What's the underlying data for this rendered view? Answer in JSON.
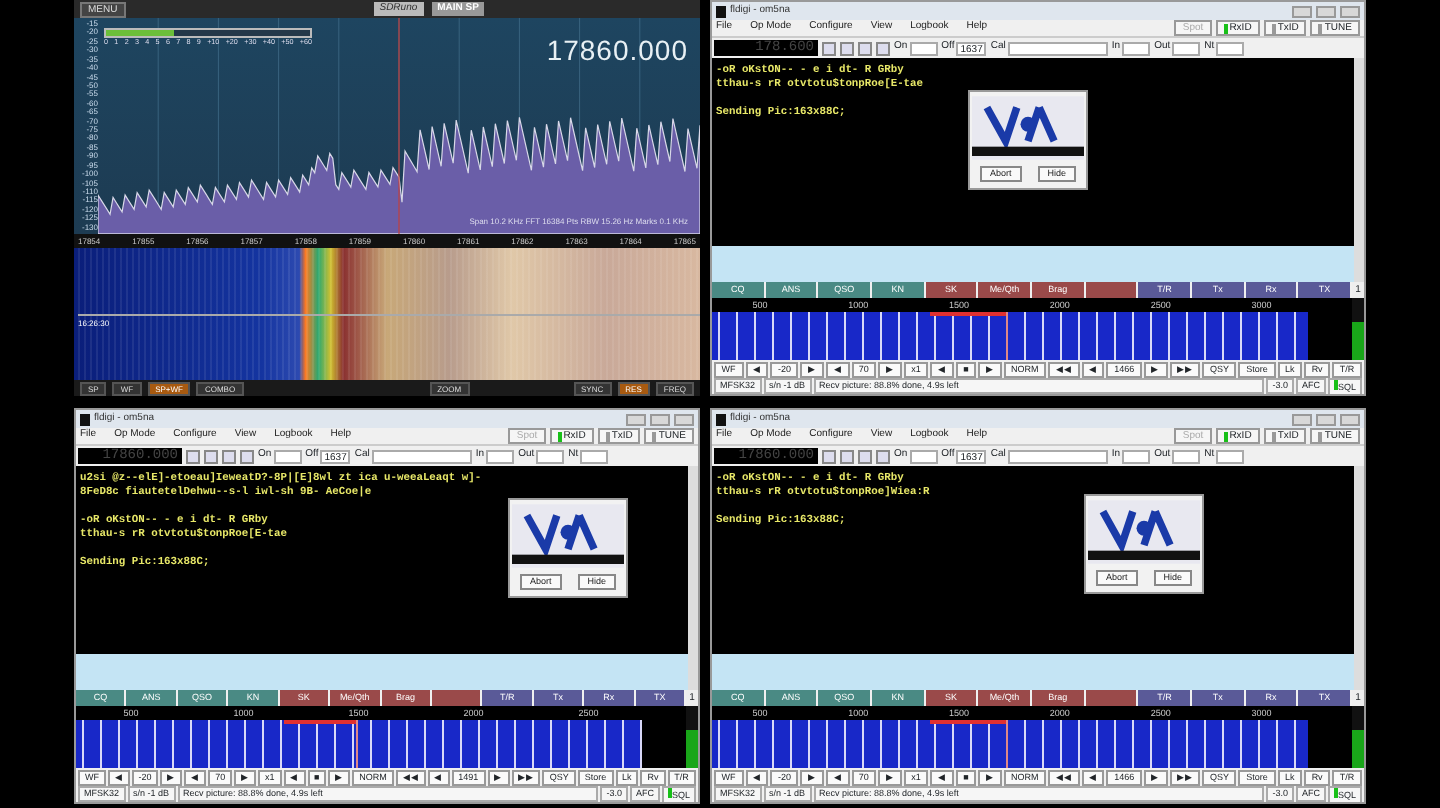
{
  "sdr": {
    "menu_button": "MENU",
    "logo": "SDRuno",
    "tab": "MAIN SP",
    "frequency": "17860.000",
    "smeter": {
      "level": 0.33,
      "scale": [
        "0",
        "1",
        "2",
        "3",
        "4",
        "5",
        "6",
        "7",
        "8",
        "9",
        "+10",
        "+20",
        "+30",
        "+40",
        "+50",
        "+60"
      ]
    },
    "db_scale": [
      "-15",
      "-20",
      "-25",
      "-30",
      "-35",
      "-40",
      "-45",
      "-50",
      "-55",
      "-60",
      "-65",
      "-70",
      "-75",
      "-80",
      "-85",
      "-90",
      "-95",
      "-100",
      "-105",
      "-110",
      "-115",
      "-120",
      "-125",
      "-130"
    ],
    "info": "Span 10.2 KHz   FFT 16384 Pts   RBW 15.26 Hz   Marks 0.1 KHz",
    "freq_axis": [
      "17854",
      "17855",
      "17856",
      "17857",
      "17858",
      "17859",
      "17860",
      "17861",
      "17862",
      "17863",
      "17864",
      "17865"
    ],
    "timestamp": "16:26:30",
    "buttons": [
      {
        "label": "SP",
        "selected": false
      },
      {
        "label": "WF",
        "selected": false
      },
      {
        "label": "SP+WF",
        "selected": true
      },
      {
        "label": "COMBO",
        "selected": false
      }
    ],
    "zoom": "ZOOM",
    "right_buttons": [
      {
        "label": "SYNC",
        "selected": false
      },
      {
        "label": "RES",
        "selected": true
      },
      {
        "label": "FREQ",
        "selected": false
      }
    ]
  },
  "fldigi_windows": [
    {
      "title": "fldigi - om5na",
      "menu": [
        "File",
        "Op Mode",
        "Configure",
        "View",
        "Logbook",
        "Help"
      ],
      "buttons": [
        {
          "label": "Spot",
          "on": false,
          "disabled": true
        },
        {
          "label": "RxID",
          "on": true,
          "disabled": false
        },
        {
          "label": "TxID",
          "on": false,
          "disabled": false
        },
        {
          "label": "TUNE",
          "on": false,
          "disabled": false
        }
      ],
      "frequency": "178.600",
      "fields": [
        {
          "label": "On"
        },
        {
          "label": "Off",
          "value": "1637"
        },
        {
          "label": "Cal"
        },
        {
          "label": "In"
        },
        {
          "label": "Out"
        },
        {
          "label": "Nt"
        }
      ],
      "rx_paragraphs": [
        [
          "-oR oKstON-- - e i dt- R GRby",
          "tthau-s rR otvtotu$tonpRoe[E-tae"
        ],
        [
          "Sending Pic:163x88C;"
        ]
      ],
      "popup": {
        "buttons": [
          "Abort",
          "Hide"
        ]
      },
      "macros": [
        {
          "label": "CQ",
          "color": "#4a8a84"
        },
        {
          "label": "ANS",
          "color": "#4a8a84"
        },
        {
          "label": "QSO",
          "color": "#4a8a84"
        },
        {
          "label": "KN",
          "color": "#4a8a84"
        },
        {
          "label": "SK",
          "color": "#9a4a4a"
        },
        {
          "label": "Me/Qth",
          "color": "#9a4a4a"
        },
        {
          "label": "Brag",
          "color": "#9a4a4a"
        },
        {
          "color": "#9a4a4a"
        },
        {
          "label": "T/R",
          "color": "#5a5a98"
        },
        {
          "label": "Tx",
          "color": "#5a5a98"
        },
        {
          "label": "Rx",
          "color": "#5a5a98"
        },
        {
          "label": "TX",
          "color": "#5a5a98"
        }
      ],
      "macro_page": "1",
      "wf_scale": [
        "500",
        "1000",
        "1500",
        "2000",
        "2500",
        "3000"
      ],
      "controls": [
        "WF",
        "◀",
        "-20",
        "▶",
        "◀",
        "70",
        "▶",
        "x1",
        "◀",
        "■",
        "▶",
        "NORM",
        "◀◀",
        "◀",
        "1466",
        "▶",
        "▶▶",
        "QSY",
        "Store",
        "Lk",
        "Rv",
        "T/R"
      ],
      "status": {
        "mode": "MFSK32",
        "snr": "s/n -1 dB",
        "message": "Recv picture: 88.8% done, 4.9s left",
        "afc_value": "-3.0",
        "afc": "AFC",
        "sql": "SQL",
        "sql_on": true
      },
      "level": 0.62
    },
    {
      "title": "fldigi - om5na",
      "menu": [
        "File",
        "Op Mode",
        "Configure",
        "View",
        "Logbook",
        "Help"
      ],
      "buttons": [
        {
          "label": "Spot",
          "on": false,
          "disabled": true
        },
        {
          "label": "RxID",
          "on": true,
          "disabled": false
        },
        {
          "label": "TxID",
          "on": false,
          "disabled": false
        },
        {
          "label": "TUNE",
          "on": false,
          "disabled": false
        }
      ],
      "frequency": "17860.000",
      "fields": [
        {
          "label": "On"
        },
        {
          "label": "Off",
          "value": "1637"
        },
        {
          "label": "Cal"
        },
        {
          "label": "In"
        },
        {
          "label": "Out"
        },
        {
          "label": "Nt"
        }
      ],
      "rx_paragraphs": [
        [
          "u2si @z--elE]-etoeau]IeweatD?-8P|[E]8wl zt ica u-weeaLeaqt w]-",
          "8FeD8c fiautetelDehwu--s-l iwl-sh 9B- AeCoe|e"
        ],
        [
          "-oR oKstON-- - e i dt- R GRby",
          "tthau-s rR otvtotu$tonpRoe[E-tae"
        ],
        [
          "Sending Pic:163x88C;"
        ]
      ],
      "popup": {
        "buttons": [
          "Abort",
          "Hide"
        ]
      },
      "macros": [
        {
          "label": "CQ",
          "color": "#4a8a84"
        },
        {
          "label": "ANS",
          "color": "#4a8a84"
        },
        {
          "label": "QSO",
          "color": "#4a8a84"
        },
        {
          "label": "KN",
          "color": "#4a8a84"
        },
        {
          "label": "SK",
          "color": "#9a4a4a"
        },
        {
          "label": "Me/Qth",
          "color": "#9a4a4a"
        },
        {
          "label": "Brag",
          "color": "#9a4a4a"
        },
        {
          "color": "#9a4a4a"
        },
        {
          "label": "T/R",
          "color": "#5a5a98"
        },
        {
          "label": "Tx",
          "color": "#5a5a98"
        },
        {
          "label": "Rx",
          "color": "#5a5a98"
        },
        {
          "label": "TX",
          "color": "#5a5a98"
        }
      ],
      "macro_page": "1",
      "wf_scale": [
        "500",
        "1000",
        "1500",
        "2000",
        "2500"
      ],
      "controls": [
        "WF",
        "◀",
        "-20",
        "▶",
        "◀",
        "70",
        "▶",
        "x1",
        "◀",
        "■",
        "▶",
        "NORM",
        "◀◀",
        "◀",
        "1491",
        "▶",
        "▶▶",
        "QSY",
        "Store",
        "Lk",
        "Rv",
        "T/R"
      ],
      "status": {
        "mode": "MFSK32",
        "snr": "s/n -1 dB",
        "message": "Recv picture: 88.8% done, 4.9s left",
        "afc_value": "-3.0",
        "afc": "AFC",
        "sql": "SQL",
        "sql_on": true
      },
      "level": 0.62
    },
    {
      "title": "fldigi - om5na",
      "menu": [
        "File",
        "Op Mode",
        "Configure",
        "View",
        "Logbook",
        "Help"
      ],
      "buttons": [
        {
          "label": "Spot",
          "on": false,
          "disabled": true
        },
        {
          "label": "RxID",
          "on": true,
          "disabled": false
        },
        {
          "label": "TxID",
          "on": false,
          "disabled": false
        },
        {
          "label": "TUNE",
          "on": false,
          "disabled": false
        }
      ],
      "frequency": "17860.000",
      "fields": [
        {
          "label": "On"
        },
        {
          "label": "Off",
          "value": "1637"
        },
        {
          "label": "Cal"
        },
        {
          "label": "In"
        },
        {
          "label": "Out"
        },
        {
          "label": "Nt"
        }
      ],
      "rx_paragraphs": [
        [
          "-oR oKstON-- - e i dt- R GRby",
          "tthau-s rR otvtotu$tonpRoe]Wiea:R"
        ],
        [
          "Sending Pic:163x88C;"
        ]
      ],
      "popup": {
        "buttons": [
          "Abort",
          "Hide"
        ]
      },
      "macros": [
        {
          "label": "CQ",
          "color": "#4a8a84"
        },
        {
          "label": "ANS",
          "color": "#4a8a84"
        },
        {
          "label": "QSO",
          "color": "#4a8a84"
        },
        {
          "label": "KN",
          "color": "#4a8a84"
        },
        {
          "label": "SK",
          "color": "#9a4a4a"
        },
        {
          "label": "Me/Qth",
          "color": "#9a4a4a"
        },
        {
          "label": "Brag",
          "color": "#9a4a4a"
        },
        {
          "color": "#9a4a4a"
        },
        {
          "label": "T/R",
          "color": "#5a5a98"
        },
        {
          "label": "Tx",
          "color": "#5a5a98"
        },
        {
          "label": "Rx",
          "color": "#5a5a98"
        },
        {
          "label": "TX",
          "color": "#5a5a98"
        }
      ],
      "macro_page": "1",
      "wf_scale": [
        "500",
        "1000",
        "1500",
        "2000",
        "2500",
        "3000"
      ],
      "controls": [
        "WF",
        "◀",
        "-20",
        "▶",
        "◀",
        "70",
        "▶",
        "x1",
        "◀",
        "■",
        "▶",
        "NORM",
        "◀◀",
        "◀",
        "1466",
        "▶",
        "▶▶",
        "QSY",
        "Store",
        "Lk",
        "Rv",
        "T/R"
      ],
      "status": {
        "mode": "MFSK32",
        "snr": "s/n -1 dB",
        "message": "Recv picture: 88.8% done, 4.9s left",
        "afc_value": "-3.0",
        "afc": "AFC",
        "sql": "SQL",
        "sql_on": true
      },
      "level": 0.62
    }
  ]
}
